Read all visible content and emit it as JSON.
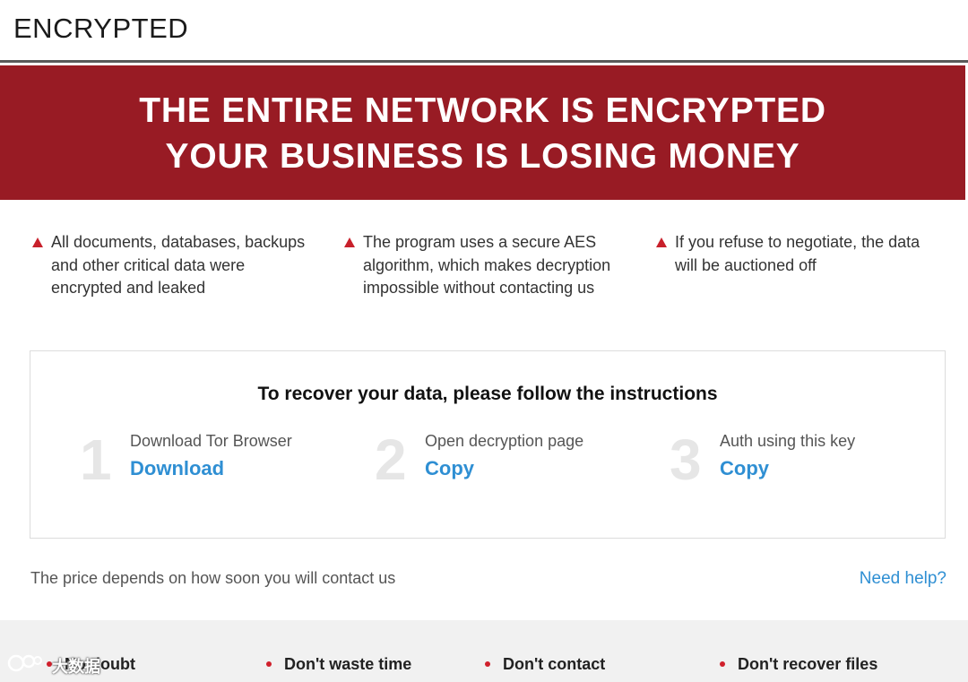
{
  "header": {
    "title": "ENCRYPTED"
  },
  "banner": {
    "line1": "THE ENTIRE NETWORK IS ENCRYPTED",
    "line2": "YOUR BUSINESS IS LOSING MONEY"
  },
  "colors": {
    "banner_bg": "#981b24",
    "link": "#2f8fd3",
    "accent_red": "#c8202b"
  },
  "features": [
    {
      "icon": "warning-triangle-icon",
      "text": "All documents, databases, backups and other critical data were encrypted and leaked"
    },
    {
      "icon": "warning-triangle-icon",
      "text": "The program uses a secure AES algorithm, which makes decryption impossible without contacting us"
    },
    {
      "icon": "warning-triangle-icon",
      "text": "If you refuse to negotiate, the data will be auctioned off"
    }
  ],
  "instructions": {
    "heading": "To recover your data, please follow the instructions",
    "steps": [
      {
        "number": "1",
        "label": "Download Tor Browser",
        "action": "Download"
      },
      {
        "number": "2",
        "label": "Open decryption page",
        "action": "Copy"
      },
      {
        "number": "3",
        "label": "Auth using this key",
        "action": "Copy"
      }
    ]
  },
  "footer": {
    "price_text": "The price depends on how soon you will contact us",
    "help_link": "Need help?"
  },
  "warnings": [
    {
      "title": "No doubt"
    },
    {
      "title": "Don't waste time"
    },
    {
      "title": "Don't contact"
    },
    {
      "title": "Don't recover files"
    }
  ],
  "watermark": {
    "text": "大数据"
  }
}
